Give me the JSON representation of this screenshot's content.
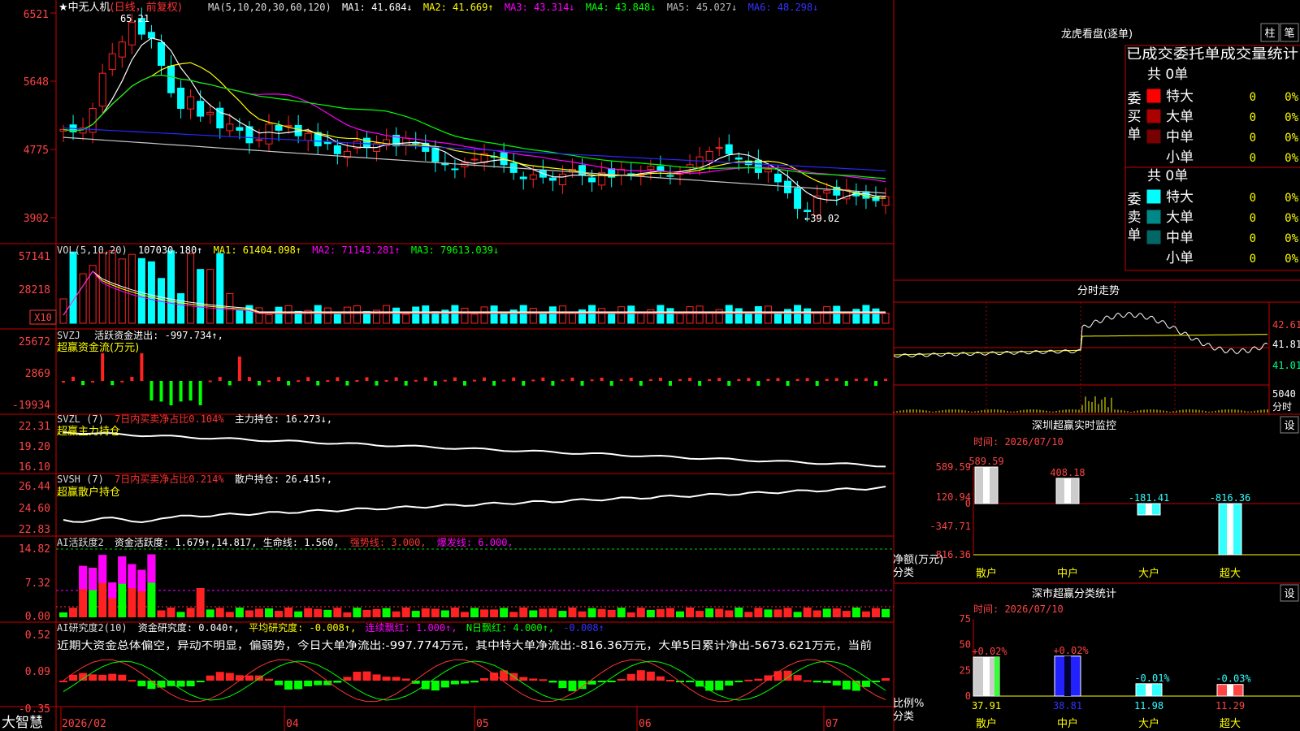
{
  "stock": {
    "title_prefix": "★",
    "name": "中无人机",
    "period": "(日线，前复权)"
  },
  "main_panel": {
    "ma_label": "MA(5,10,20,30,60,120)",
    "ma_items": [
      {
        "text": "MA1: 41.684↓",
        "color": "#ffffff"
      },
      {
        "text": "MA2: 41.669↑",
        "color": "#ffff00"
      },
      {
        "text": "MA3: 43.314↓",
        "color": "#ff00ff"
      },
      {
        "text": "MA4: 43.848↓",
        "color": "#00ff00"
      },
      {
        "text": "MA5: 45.027↓",
        "color": "#bbbbbb"
      },
      {
        "text": "MA6: 48.298↓",
        "color": "#3333ff"
      }
    ],
    "y_ticks": [
      "6521",
      "5648",
      "4775",
      "3902"
    ],
    "high_label": "65.21",
    "low_label": "←39.02",
    "colors": {
      "ma1": "#ffffff",
      "ma2": "#ffff00",
      "ma3": "#ff00ff",
      "ma4": "#00ff00",
      "ma5": "#c8c8c8",
      "ma6": "#2828ff"
    }
  },
  "vol_panel": {
    "label": "VOL(5,10,20)",
    "value": "107030.180↑",
    "items": [
      {
        "text": "MA1: 61404.098↑",
        "color": "#ffff00"
      },
      {
        "text": "MA2: 71143.281↑",
        "color": "#ff00ff"
      },
      {
        "text": "MA3: 79613.039↓",
        "color": "#00ff00"
      }
    ],
    "y_ticks": [
      "57141",
      "28218"
    ],
    "unit": "X10"
  },
  "svzj_panel": {
    "label": "SVZJ",
    "value": "活跃资金进出: -997.734↑,",
    "subtitle": "超赢资金流(万元)",
    "y_ticks": [
      "25672",
      "2869",
      "-19934"
    ]
  },
  "svzl_panel": {
    "label": "SVZL (7)",
    "ratio": "7日内买卖净占比0.104%",
    "value": "主力持仓: 16.273↓,",
    "subtitle": "超赢主力持仓",
    "y_ticks": [
      "22.31",
      "19.20",
      "16.10"
    ]
  },
  "svsh_panel": {
    "label": "SVSH (7)",
    "ratio": "7日内买卖净占比0.214%",
    "value": "散户持仓: 26.415↑,",
    "subtitle": "超赢散户持仓",
    "y_ticks": [
      "26.44",
      "24.60",
      "22.83"
    ]
  },
  "ai_active_panel": {
    "label": "AI活跃度2",
    "value": "资金活跃度: 1.679↑,14.817,",
    "life": "生命线: 1.560,",
    "strong": "强势线: 3.000,",
    "burst": "爆发线: 6.000,",
    "y_ticks": [
      "14.82",
      "7.32",
      "0.00"
    ]
  },
  "ai_research_panel": {
    "label": "AI研究度2(10)",
    "value": "资金研究度: 0.040↑,",
    "avg": "平均研究度: -0.008↑,",
    "consec": "连续飘红: 1.000↑,",
    "nday": "N日飘红: 4.000↑,",
    "last": "-0.008↑",
    "comment": "近期大资金总体偏空，异动不明显，偏弱势，今日大单净流出:-997.774万元，其中特大单净流出:-816.36万元，大单5日累计净出-5673.621万元，当前",
    "y_ticks": [
      "0.52",
      "0.09",
      "-0.35"
    ]
  },
  "x_axis": {
    "brand": "大智慧",
    "labels": [
      {
        "text": "2026/02",
        "color": "#ff4444"
      },
      {
        "text": "04",
        "color": "#ff4444"
      },
      {
        "text": "05",
        "color": "#ff4444"
      },
      {
        "text": "06",
        "color": "#ff4444"
      },
      {
        "text": "07",
        "color": "#ff4444"
      }
    ]
  },
  "right_panel": {
    "dragon_title": "龙虎看盘(逐单)",
    "btn_zhu": "柱",
    "btn_bi": "笔",
    "stats_title": "已成交委托单成交量统计",
    "buy": {
      "vertical": [
        "委",
        "买",
        "单"
      ],
      "total": "共 0单",
      "rows": [
        {
          "name": "特大",
          "count": "0",
          "pct": "0%",
          "color": "#ff0000"
        },
        {
          "name": "大单",
          "count": "0",
          "pct": "0%",
          "color": "#aa0000"
        },
        {
          "name": "中单",
          "count": "0",
          "pct": "0%",
          "color": "#770000"
        },
        {
          "name": "小单",
          "count": "0",
          "pct": "0%",
          "color": "#000000"
        }
      ]
    },
    "sell": {
      "vertical": [
        "委",
        "卖",
        "单"
      ],
      "total": "共 0单",
      "rows": [
        {
          "name": "特大",
          "count": "0",
          "pct": "0%",
          "color": "#00ffff"
        },
        {
          "name": "大单",
          "count": "0",
          "pct": "0%",
          "color": "#008888"
        },
        {
          "name": "中单",
          "count": "0",
          "pct": "0%",
          "color": "#006666"
        },
        {
          "name": "小单",
          "count": "0",
          "pct": "0%",
          "color": "#000000"
        }
      ]
    },
    "intraday": {
      "title": "分时走势",
      "ticks": [
        "42.61",
        "41.81",
        "41.01"
      ],
      "vol_tick": "5040",
      "vol_label": "分时"
    },
    "monitor": {
      "title": "深圳超赢实时监控",
      "btn": "设",
      "date": "时间: 2026/07/10",
      "y_ticks": [
        "589.59",
        "120.94",
        "0",
        "-347.71",
        "-816.36"
      ],
      "side_label_1": "净额(万元)",
      "side_label_2": "分类",
      "chart_data": {
        "type": "bar",
        "categories": [
          "散户",
          "中户",
          "大户",
          "超大"
        ],
        "values": [
          589.59,
          408.18,
          -181.41,
          -816.36
        ],
        "ylim": [
          -816.36,
          589.59
        ]
      },
      "value_labels": [
        "589.59",
        "408.18",
        "-181.41",
        "-816.36"
      ]
    },
    "classify": {
      "title": "深市超赢分类统计",
      "btn": "设",
      "date": "时间: 2026/07/10",
      "y_ticks": [
        "75",
        "50",
        "25",
        "0"
      ],
      "side_label_1": "比例%",
      "side_label_2": "分类",
      "chart_data": {
        "type": "bar",
        "categories": [
          "散户",
          "中户",
          "大户",
          "超大"
        ],
        "values": [
          37.91,
          38.81,
          11.98,
          11.29
        ],
        "ylim": [
          0,
          75
        ]
      },
      "change_labels": [
        "+0.02%",
        "+0.02%",
        "-0.01%",
        "-0.03%"
      ],
      "value_labels": [
        "37.91",
        "38.81",
        "11.98",
        "11.29"
      ]
    }
  },
  "chart_data": [
    {
      "type": "candlestick",
      "title": "中无人机 (日线，前复权)",
      "ylabel": "",
      "ylim": [
        38.2,
        66.5
      ],
      "close_start": 50.3,
      "close_path": [
        50.3,
        50.0,
        50.5,
        53.0,
        57.5,
        60.0,
        61.5,
        64.0,
        62.5,
        62.0,
        58.5,
        55.0,
        53.0,
        54.5,
        52.0,
        52.5,
        50.5,
        51.0,
        50.2,
        48.6,
        49.0,
        51.0,
        50.2,
        50.8,
        49.5,
        49.8,
        48.2,
        48.5,
        47.2,
        47.5,
        48.8,
        48.0,
        48.5,
        49.0,
        48.2,
        49.2,
        48.5,
        47.5,
        46.2,
        45.8,
        45.2,
        46.0,
        46.5,
        47.2,
        46.8,
        45.8,
        44.8,
        44.0,
        44.5,
        44.2,
        43.8,
        44.6,
        45.2,
        44.5,
        43.6,
        44.8,
        44.2,
        45.2,
        44.5,
        44.6,
        45.6,
        45.0,
        44.4,
        44.9,
        45.8,
        46.8,
        47.5,
        48.0,
        47.2,
        46.5,
        45.8,
        44.8,
        45.2,
        43.6,
        42.2,
        40.2,
        39.8,
        41.8,
        42.5,
        41.9,
        42.6,
        41.8,
        41.5,
        41.2,
        41.7
      ],
      "high": 65.21,
      "low": 39.02
    }
  ]
}
